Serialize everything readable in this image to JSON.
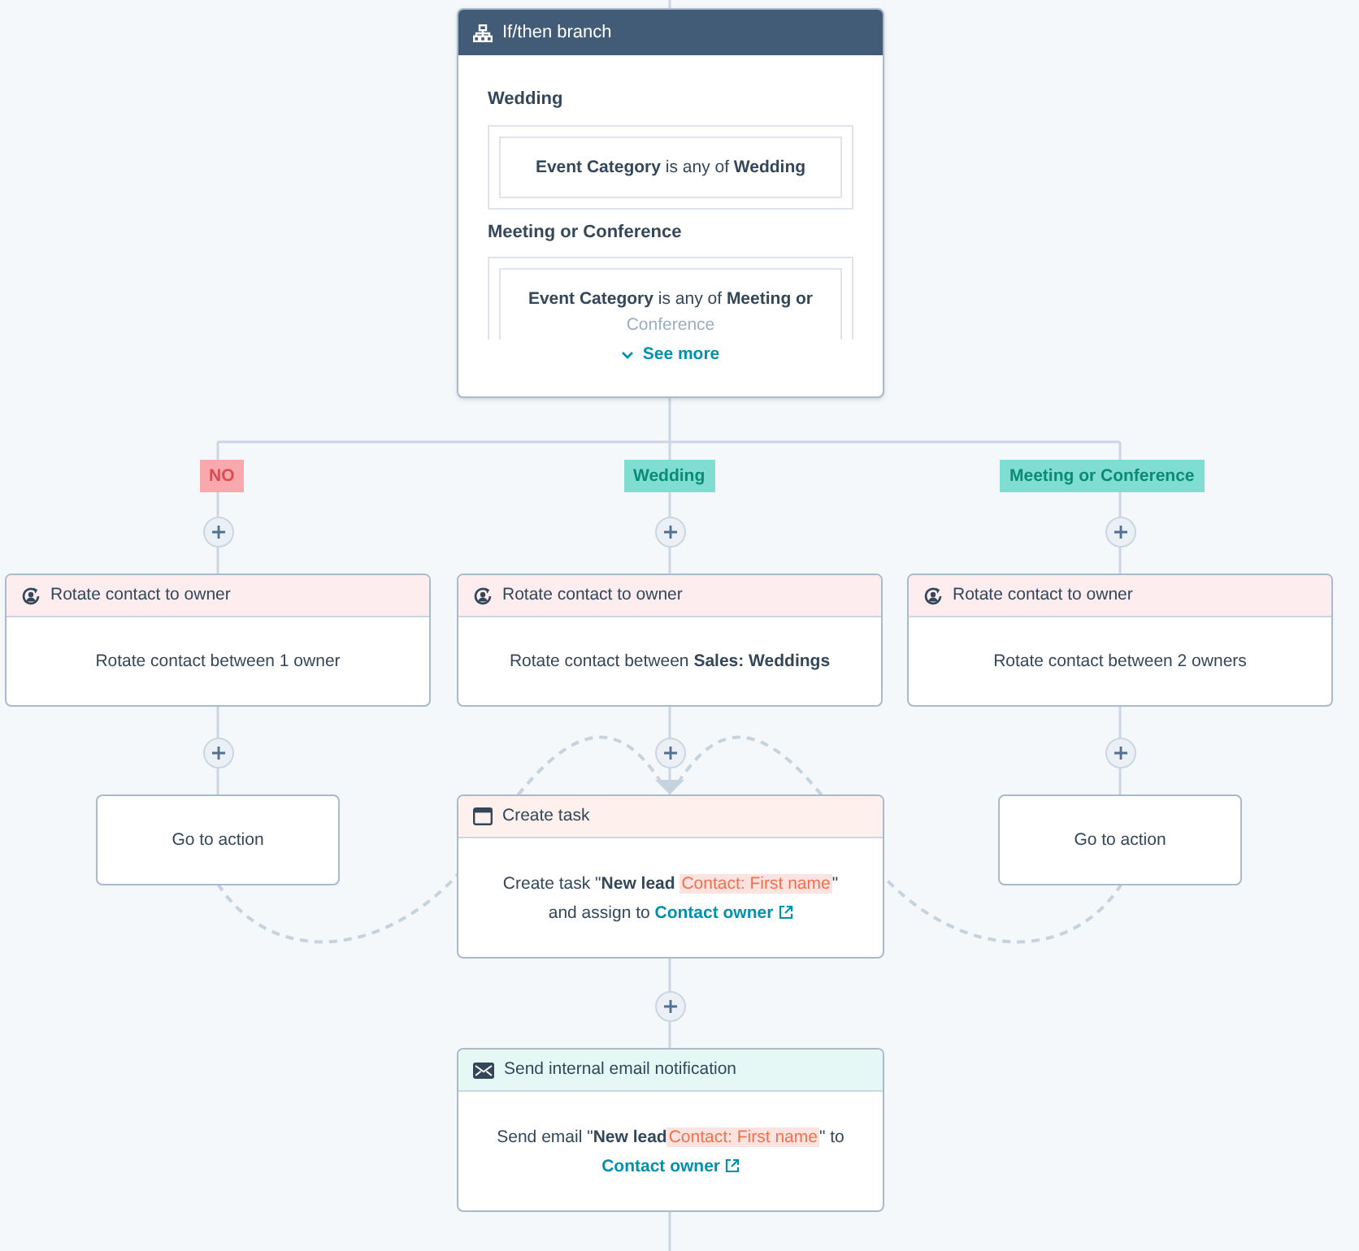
{
  "branch_node": {
    "title": "If/then branch",
    "branches": [
      {
        "label": "Wedding",
        "condition": "**Event Category** is any of **Wedding**"
      },
      {
        "label": "Meeting or Conference",
        "condition": "**Event Category** is any of **Meeting or**",
        "overflow": "Conference"
      }
    ],
    "see_more": "See more"
  },
  "columns": [
    {
      "tag": {
        "label": "NO",
        "kind": "none"
      },
      "actions": [
        {
          "kind": "rotate",
          "title": "Rotate contact to owner",
          "body": [
            {
              "kind": "text",
              "text": "Rotate contact between 1 owner"
            }
          ]
        },
        {
          "kind": "goto",
          "body": [
            {
              "kind": "text",
              "text": "Go to action"
            }
          ]
        }
      ]
    },
    {
      "tag": {
        "label": "Wedding",
        "kind": "match"
      },
      "actions": [
        {
          "kind": "rotate",
          "title": "Rotate contact to owner",
          "body": [
            {
              "kind": "text",
              "text": "Rotate contact between **Sales: Weddings**"
            }
          ]
        },
        {
          "kind": "task",
          "title": "Create task",
          "body": [
            {
              "kind": "text",
              "text": "Create task \"**New lead** "
            },
            {
              "kind": "token",
              "text": "Contact: First name"
            },
            {
              "kind": "text",
              "text": "\""
            },
            {
              "kind": "break"
            },
            {
              "kind": "text",
              "text": "and assign to "
            },
            {
              "kind": "link",
              "text": "Contact owner"
            }
          ]
        },
        {
          "kind": "email",
          "title": "Send internal email notification",
          "body": [
            {
              "kind": "text",
              "text": "Send email \"**New lead**"
            },
            {
              "kind": "token",
              "text": "Contact: First name"
            },
            {
              "kind": "text",
              "text": "\" to"
            },
            {
              "kind": "break"
            },
            {
              "kind": "link",
              "text": "Contact owner"
            }
          ]
        }
      ]
    },
    {
      "tag": {
        "label": "Meeting or Conference",
        "kind": "match"
      },
      "actions": [
        {
          "kind": "rotate",
          "title": "Rotate contact to owner",
          "body": [
            {
              "kind": "text",
              "text": "Rotate contact between 2 owners"
            }
          ]
        },
        {
          "kind": "goto",
          "body": [
            {
              "kind": "text",
              "text": "Go to action"
            }
          ]
        }
      ]
    }
  ]
}
